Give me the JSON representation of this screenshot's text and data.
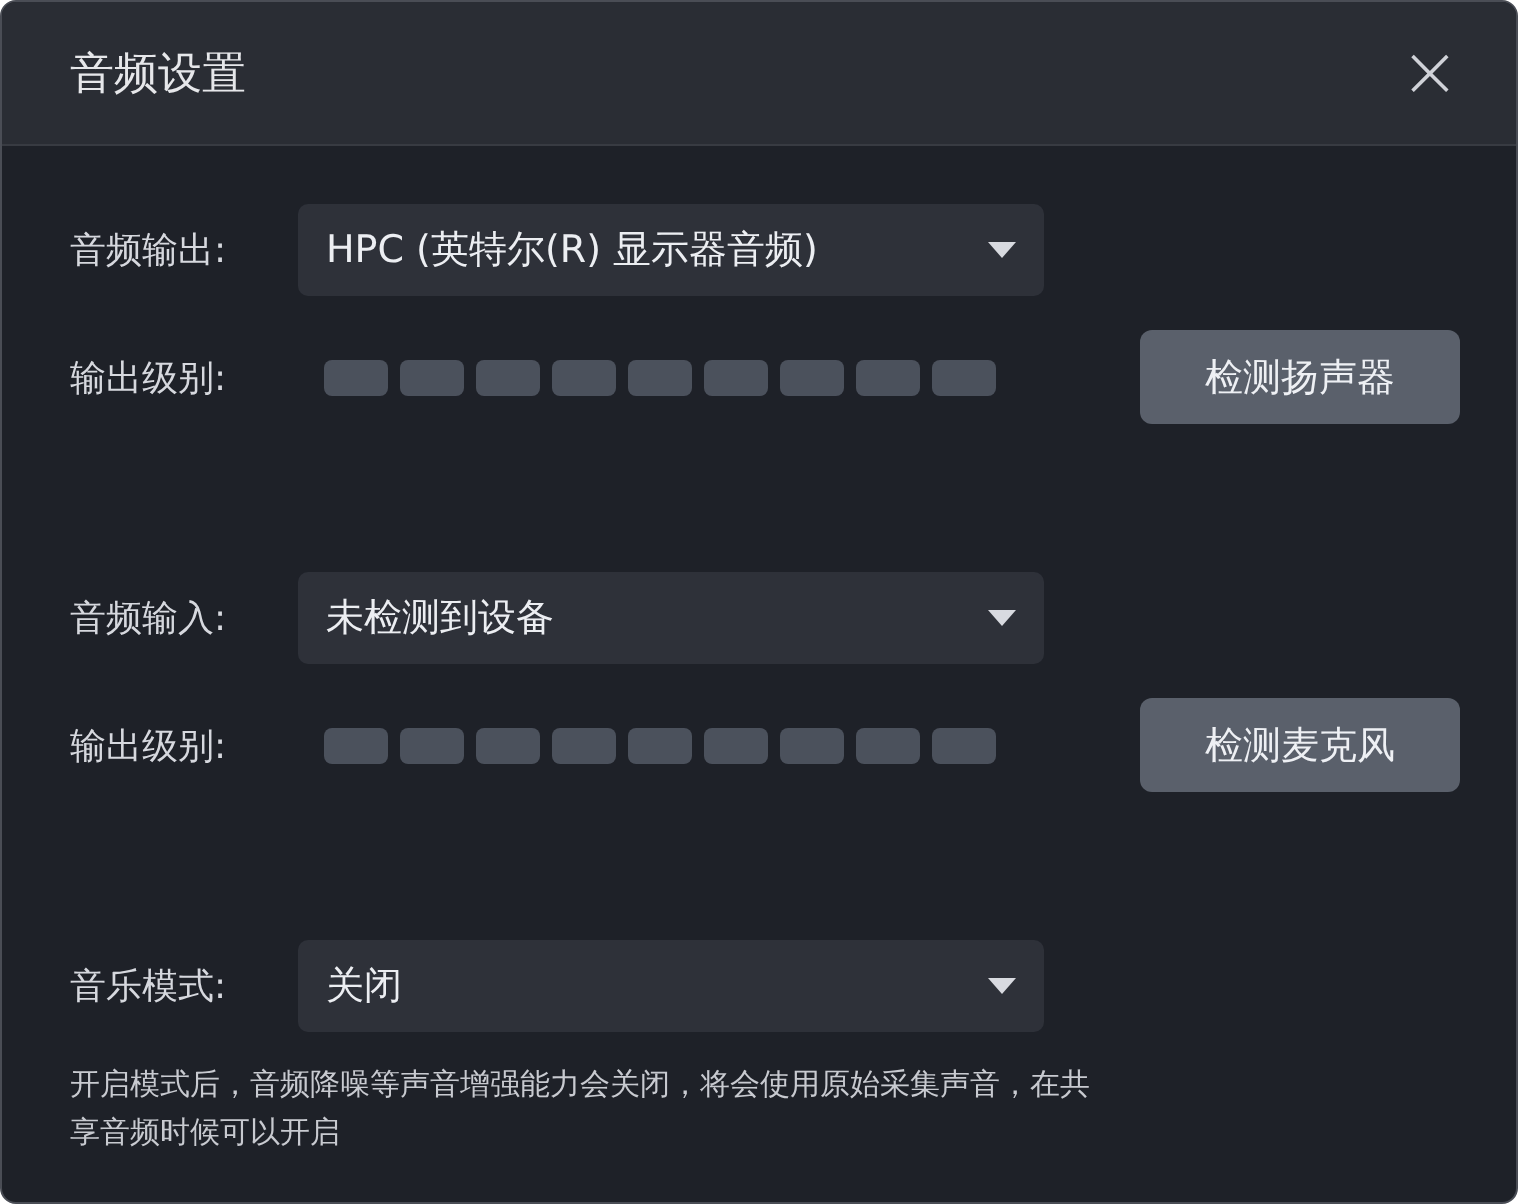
{
  "window": {
    "title": "音频设置",
    "close": "×"
  },
  "sections": [
    {
      "kind": "device",
      "label": "音频输出:",
      "value": "HPC (英特尔(R) 显示器音频)",
      "meter_label": "输出级别:",
      "button": "检测扬声器"
    },
    {
      "kind": "device",
      "label": "音频输入:",
      "value": "未检测到设备",
      "meter_label": "输出级别:",
      "button": "检测麦克风"
    },
    {
      "kind": "mode",
      "label": "音乐模式:",
      "value": "关闭",
      "note": "开启模式后，音频降噪等声音增强能力会关闭，将会使用原始采集声音，在共享音频时候可以开启"
    }
  ]
}
